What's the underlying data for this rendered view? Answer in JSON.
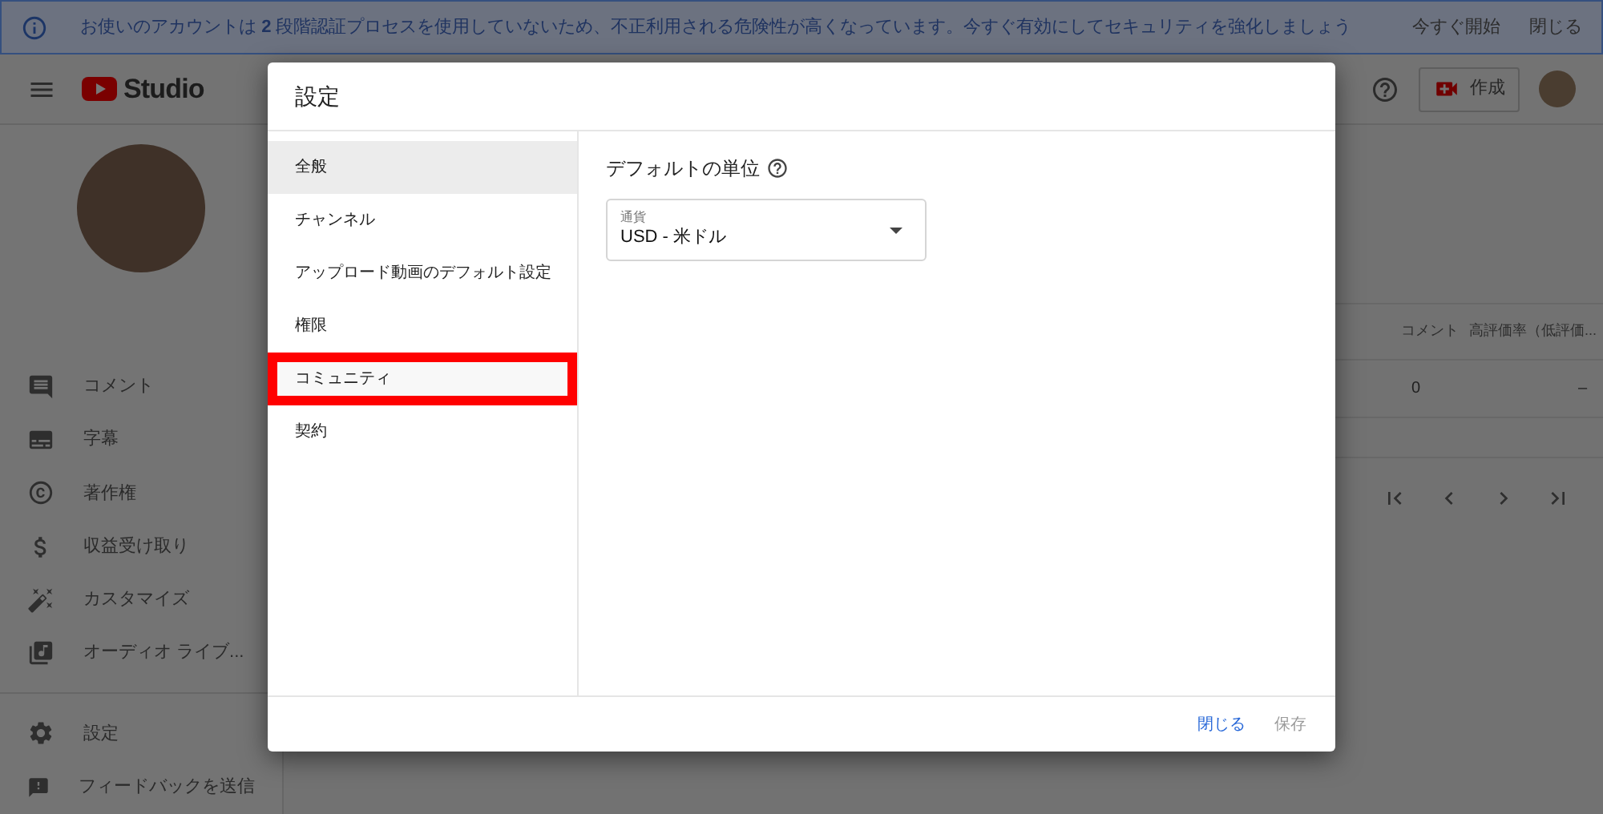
{
  "banner": {
    "message": "お使いのアカウントは **2** 段階認証プロセスを使用していないため、不正利用される危険性が高くなっています。今すぐ有効にしてセキュリティを強化しましょう",
    "actions": [
      "今すぐ開始",
      "閉じる"
    ]
  },
  "header": {
    "logo_text": "Studio",
    "create_label": "作成"
  },
  "sidebar": {
    "items": [
      {
        "label": "コメント"
      },
      {
        "label": "字幕"
      },
      {
        "label": "著作権"
      },
      {
        "label": "収益受け取り"
      },
      {
        "label": "カスタマイズ"
      },
      {
        "label": "オーディオ ライブ..."
      }
    ],
    "bottom_items": [
      {
        "label": "設定"
      },
      {
        "label": "フィードバックを送信"
      }
    ]
  },
  "table": {
    "columns": [
      "コメント",
      "高評価率（低評価..."
    ],
    "rows": [
      [
        "0",
        "–"
      ]
    ]
  },
  "dialog": {
    "title": "設定",
    "nav": [
      {
        "label": "全般",
        "selected": true,
        "highlighted": false
      },
      {
        "label": "チャンネル",
        "selected": false,
        "highlighted": false
      },
      {
        "label": "アップロード動画のデフォルト設定",
        "selected": false,
        "highlighted": false
      },
      {
        "label": "権限",
        "selected": false,
        "highlighted": false
      },
      {
        "label": "コミュニティ",
        "selected": false,
        "highlighted": true
      },
      {
        "label": "契約",
        "selected": false,
        "highlighted": false
      }
    ],
    "section_title": "デフォルトの単位",
    "currency": {
      "label": "通貨",
      "value": "USD - 米ドル"
    },
    "buttons": [
      {
        "label": "閉じる",
        "disabled": false
      },
      {
        "label": "保存",
        "disabled": true
      }
    ]
  }
}
